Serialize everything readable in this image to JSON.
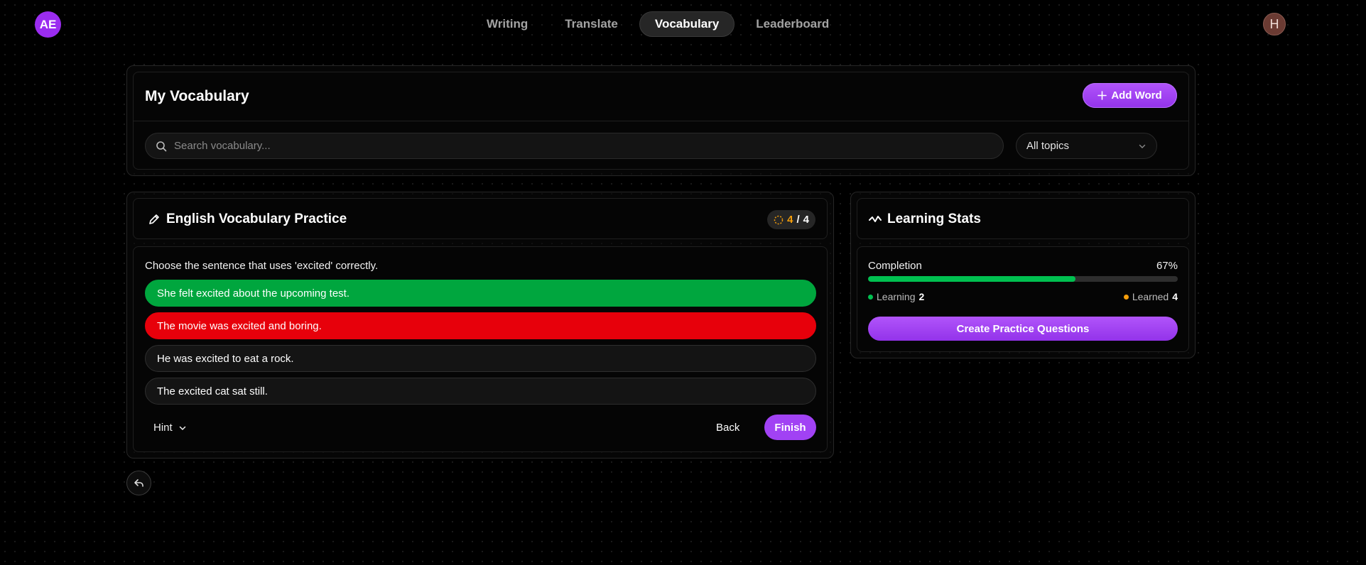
{
  "app": {
    "logo_text": "AE",
    "avatar_initial": "H"
  },
  "nav": {
    "items": [
      {
        "label": "Writing",
        "active": false
      },
      {
        "label": "Translate",
        "active": false
      },
      {
        "label": "Vocabulary",
        "active": true
      },
      {
        "label": "Leaderboard",
        "active": false
      }
    ]
  },
  "vocabulary": {
    "title": "My Vocabulary",
    "add_button": "Add Word",
    "add_icon": "plus-icon",
    "search_placeholder": "Search vocabulary...",
    "search_value": "",
    "topic_filter": "All topics"
  },
  "practice": {
    "title": "English Vocabulary Practice",
    "title_icon": "pencil-icon",
    "counter_current": "4",
    "counter_separator": "/",
    "counter_total": "4",
    "question": "Choose the sentence that uses 'excited' correctly.",
    "options": [
      {
        "text": "She felt excited about the upcoming test.",
        "state": "correct"
      },
      {
        "text": "The movie was excited and boring.",
        "state": "wrong"
      },
      {
        "text": "He was excited to eat a rock.",
        "state": "neutral"
      },
      {
        "text": "The excited cat sat still.",
        "state": "neutral"
      }
    ],
    "hint_label": "Hint",
    "back_label": "Back",
    "finish_label": "Finish"
  },
  "stats": {
    "title": "Learning Stats",
    "title_icon": "activity-icon",
    "completion_label": "Completion",
    "completion_value": "67%",
    "completion_fraction": 0.67,
    "learning_label": "Learning",
    "learning_count": "2",
    "learned_label": "Learned",
    "learned_count": "4",
    "create_button": "Create Practice Questions"
  },
  "colors": {
    "accent": "#a142f4",
    "correct": "#00a63e",
    "wrong": "#e7000b",
    "progress": "#00c050",
    "learning_dot": "#00c050",
    "learned_dot": "#f59e0b"
  }
}
